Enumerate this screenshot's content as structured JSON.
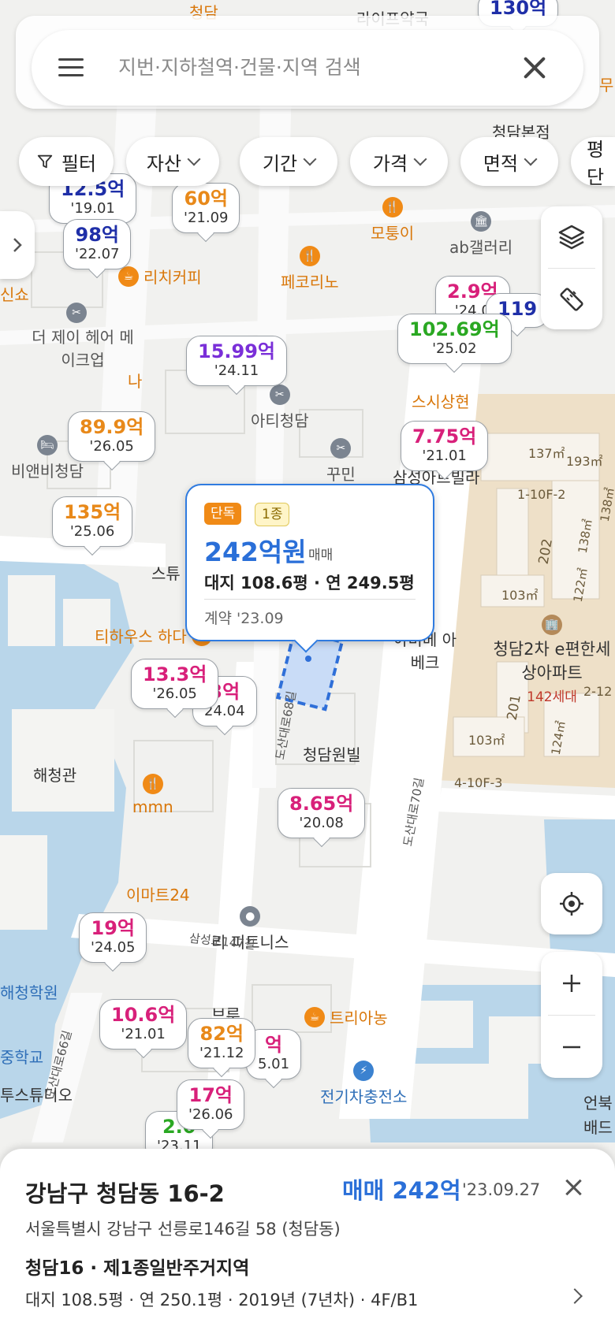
{
  "search": {
    "placeholder": "지번·지하철역·건물·지역 검색"
  },
  "filters": [
    {
      "label": "필터"
    },
    {
      "label": "자산"
    },
    {
      "label": "기간"
    },
    {
      "label": "가격"
    },
    {
      "label": "면적"
    },
    {
      "label": "평단"
    }
  ],
  "map": {
    "places": [
      "청담",
      "라이프약국",
      "리치커피",
      "더 제이 헤어 메이크업",
      "페코리노",
      "모퉁이",
      "ab갤러리",
      "아티청담",
      "꾸민",
      "삼성아트빌라",
      "비앤비청담",
      "스시상현",
      "티하우스 하다",
      "청담원빌",
      "해청관",
      "mmn",
      "아비베 아베크",
      "청담2차 e편한세상아파트",
      "142세대",
      "리 피트니스",
      "트리아농",
      "전기차충전소",
      "해청학원",
      "중학교",
      "투스튜디오",
      "언북",
      "배드",
      "이마트24",
      "도산대로68길",
      "도산대로70길",
      "삼성로147길",
      "도산대로66길",
      "청담본점",
      "나",
      "스튜",
      "신쇼",
      "브루",
      "무"
    ],
    "parcel_labels": [
      "137㎡",
      "193㎡",
      "1-10F-2",
      "138㎡",
      "138㎡",
      "202",
      "103㎡",
      "122㎡",
      "201",
      "2-12",
      "103㎡",
      "124㎡",
      "4-10F-3"
    ],
    "price_bubbles": [
      {
        "price": "130억",
        "date": "",
        "color": "#1f2fa8"
      },
      {
        "price": "12.5억",
        "date": "'19.01",
        "color": "#1f2fa8"
      },
      {
        "price": "98억",
        "date": "'22.07",
        "color": "#1f2fa8"
      },
      {
        "price": "60억",
        "date": "'21.09",
        "color": "#e8891a"
      },
      {
        "price": "15.99억",
        "date": "'24.11",
        "color": "#7a2fd8"
      },
      {
        "price": "89.9억",
        "date": "'26.05",
        "color": "#e8891a"
      },
      {
        "price": "135억",
        "date": "'25.06",
        "color": "#e8891a"
      },
      {
        "price": "2.9억",
        "date": "'24.0",
        "color": "#d8207a"
      },
      {
        "price": "119",
        "date": "",
        "color": "#1f2fa8"
      },
      {
        "price": "102.69억",
        "date": "'25.02",
        "color": "#2aa822"
      },
      {
        "price": "7.75억",
        "date": "'21.01",
        "color": "#d8207a"
      },
      {
        "price": "13.3억",
        "date": "'26.05",
        "color": "#d8207a"
      },
      {
        "price": "3억",
        "date": "24.04",
        "color": "#d8207a"
      },
      {
        "price": "8.65억",
        "date": "'20.08",
        "color": "#d8207a"
      },
      {
        "price": "19억",
        "date": "'24.05",
        "color": "#d8207a"
      },
      {
        "price": "10.6억",
        "date": "'21.01",
        "color": "#d8207a"
      },
      {
        "price": "82억",
        "date": "'21.12",
        "color": "#e8891a"
      },
      {
        "price": "억",
        "date": "5.01",
        "color": "#d8207a"
      },
      {
        "price": "17억",
        "date": "'26.06",
        "color": "#d8207a"
      },
      {
        "price": "2.0",
        "date": "'23.11",
        "color": "#2aa822"
      }
    ]
  },
  "selected_popup": {
    "tag_type": "단독",
    "tag_zone": "1종",
    "price": "242억원",
    "trade_type": "매매",
    "size": "대지 108.6평 · 연 249.5평",
    "contract": "계약 '23.09"
  },
  "bottom_sheet": {
    "address": "강남구 청담동 16-2",
    "sale": "매매 242억",
    "sale_date": "'23.09.27",
    "road_address": "서울특별시 강남구 선릉로146길 58 (청담동)",
    "zone": "청담16 · 제1종일반주거지역",
    "details": "대지 108.5평 · 연 250.1평 · 2019년 (7년차) · 4F/B1"
  },
  "colors": {
    "accent": "#2f7be0",
    "water": "#b9d6ea",
    "apartment_area": "#eee0c8"
  }
}
